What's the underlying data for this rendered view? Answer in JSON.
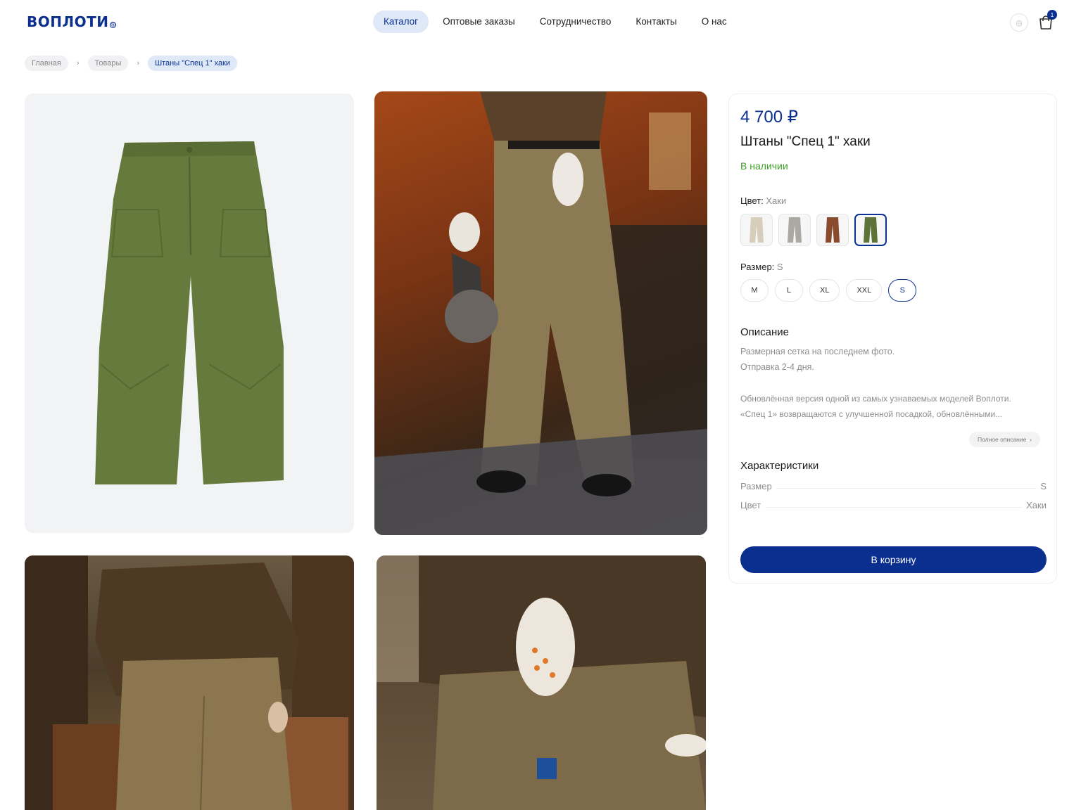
{
  "header": {
    "logo": "ВОПЛОТИ",
    "nav": [
      {
        "label": "Каталог",
        "active": true
      },
      {
        "label": "Оптовые заказы"
      },
      {
        "label": "Сотрудничество"
      },
      {
        "label": "Контакты"
      },
      {
        "label": "О нас"
      }
    ],
    "cart_count": "1",
    "icons": [
      "circle-icon",
      "cart-icon"
    ]
  },
  "breadcrumbs": [
    "Главная",
    "Товары",
    "Штаны \"Спец 1\" хаки"
  ],
  "product": {
    "price": "4 700 ₽",
    "title": "Штаны \"Спец 1\" хаки",
    "stock": "В наличии",
    "color_label": "Цвет:",
    "color_value": "Хаки",
    "swatch_colors": [
      "#d6cdbb",
      "#a9a8a1",
      "#8a4a2c",
      "#5c7236"
    ],
    "selected_swatch": 3,
    "size_label": "Размер:",
    "size_value": "S",
    "sizes": [
      "M",
      "L",
      "XL",
      "XXL",
      "S"
    ],
    "selected_size": "S",
    "description_title": "Описание",
    "description_lines": [
      "Размерная сетка на последнем фото.",
      "Отправка 2-4 дня."
    ],
    "description_body": [
      "Обновлённая версия одной из самых узнаваемых моделей Воплоти.",
      "«Спец 1» возвращаются с улучшенной посадкой, обновлёнными..."
    ],
    "more_label": "Полное описание",
    "specs_title": "Характеристики",
    "specs": [
      {
        "name": "Размер",
        "value": "S"
      },
      {
        "name": "Цвет",
        "value": "Хаки"
      }
    ],
    "cart_button": "В корзину"
  },
  "colors": {
    "brand": "#0b2f8f",
    "accent_bg": "#dfe8f7",
    "in_stock": "#3fa02a",
    "khaki": "#667a3e"
  }
}
